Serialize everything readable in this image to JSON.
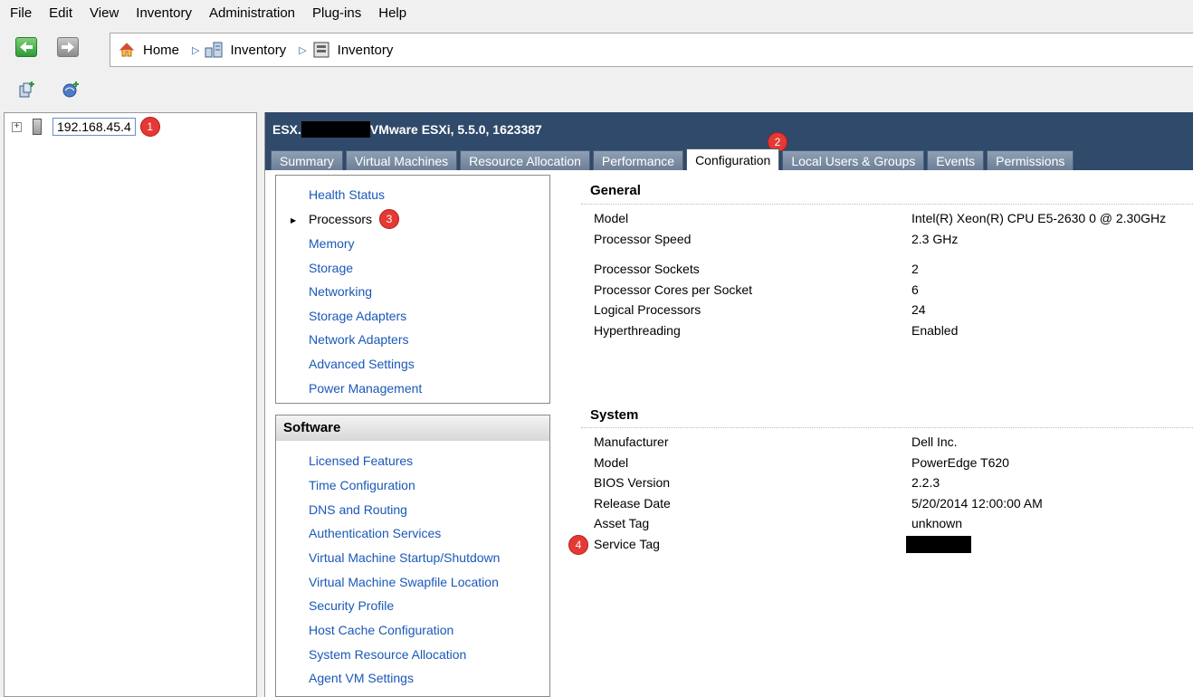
{
  "menubar": {
    "items": [
      "File",
      "Edit",
      "View",
      "Inventory",
      "Administration",
      "Plug-ins",
      "Help"
    ]
  },
  "navigation": {
    "breadcrumbs": [
      {
        "label": "Home",
        "icon": "home-icon"
      },
      {
        "label": "Inventory",
        "icon": "inventory-icon"
      },
      {
        "label": "Inventory",
        "icon": "host-inventory-icon"
      }
    ]
  },
  "tree": {
    "host_label": "192.168.45.4",
    "badge": "1"
  },
  "host_header": {
    "title_prefix": "ESX.",
    "title_suffix": "VMware ESXi, 5.5.0, 1623387"
  },
  "tabs": [
    {
      "label": "Summary",
      "active": false
    },
    {
      "label": "Virtual Machines",
      "active": false
    },
    {
      "label": "Resource Allocation",
      "active": false
    },
    {
      "label": "Performance",
      "active": false
    },
    {
      "label": "Configuration",
      "active": true
    },
    {
      "label": "Local Users & Groups",
      "active": false
    },
    {
      "label": "Events",
      "active": false
    },
    {
      "label": "Permissions",
      "active": false
    }
  ],
  "tab_badge": "2",
  "hardware_menu": {
    "items": [
      "Health Status",
      "Processors",
      "Memory",
      "Storage",
      "Networking",
      "Storage Adapters",
      "Network Adapters",
      "Advanced Settings",
      "Power Management"
    ],
    "current": "Processors",
    "badge": "3"
  },
  "software_menu": {
    "title": "Software",
    "items": [
      "Licensed Features",
      "Time Configuration",
      "DNS and Routing",
      "Authentication Services",
      "Virtual Machine Startup/Shutdown",
      "Virtual Machine Swapfile Location",
      "Security Profile",
      "Host Cache Configuration",
      "System Resource Allocation",
      "Agent VM Settings"
    ]
  },
  "general": {
    "title": "General",
    "rows": [
      {
        "label": "Model",
        "value": "Intel(R) Xeon(R) CPU E5-2630 0 @ 2.30GHz"
      },
      {
        "label": "Processor Speed",
        "value": "2.3 GHz"
      },
      {
        "label": "Processor Sockets",
        "value": "2"
      },
      {
        "label": "Processor Cores per Socket",
        "value": "6"
      },
      {
        "label": "Logical Processors",
        "value": "24"
      },
      {
        "label": "Hyperthreading",
        "value": "Enabled"
      }
    ]
  },
  "system": {
    "title": "System",
    "rows": [
      {
        "label": "Manufacturer",
        "value": "Dell Inc."
      },
      {
        "label": "Model",
        "value": "PowerEdge T620"
      },
      {
        "label": "BIOS Version",
        "value": "2.2.3"
      },
      {
        "label": "Release Date",
        "value": "5/20/2014 12:00:00 AM"
      },
      {
        "label": "Asset Tag",
        "value": "unknown"
      },
      {
        "label": "Service Tag",
        "value": ""
      }
    ],
    "badge": "4"
  },
  "colors": {
    "link": "#1a58b8",
    "header_bg": "#2f4a6a",
    "badge": "#e53935"
  }
}
